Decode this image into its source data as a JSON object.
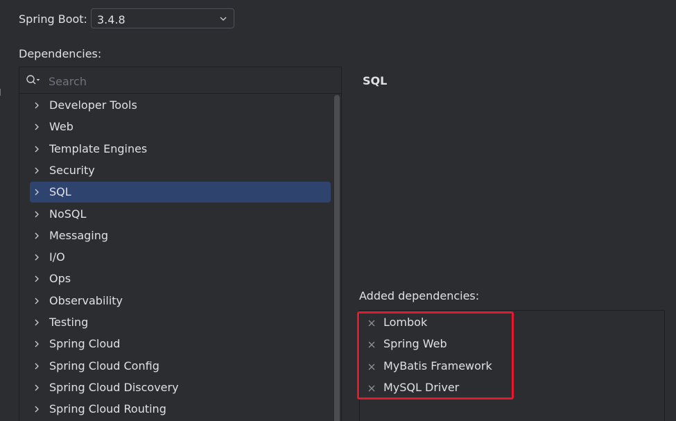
{
  "spring_boot": {
    "label": "Spring Boot:",
    "version": "3.4.8"
  },
  "dependencies": {
    "label": "Dependencies:",
    "search_placeholder": "Search",
    "categories": [
      {
        "label": "Developer Tools",
        "selected": false
      },
      {
        "label": "Web",
        "selected": false
      },
      {
        "label": "Template Engines",
        "selected": false
      },
      {
        "label": "Security",
        "selected": false
      },
      {
        "label": "SQL",
        "selected": true
      },
      {
        "label": "NoSQL",
        "selected": false
      },
      {
        "label": "Messaging",
        "selected": false
      },
      {
        "label": "I/O",
        "selected": false
      },
      {
        "label": "Ops",
        "selected": false
      },
      {
        "label": "Observability",
        "selected": false
      },
      {
        "label": "Testing",
        "selected": false
      },
      {
        "label": "Spring Cloud",
        "selected": false
      },
      {
        "label": "Spring Cloud Config",
        "selected": false
      },
      {
        "label": "Spring Cloud Discovery",
        "selected": false
      },
      {
        "label": "Spring Cloud Routing",
        "selected": false
      }
    ]
  },
  "detail": {
    "title": "SQL"
  },
  "added": {
    "label": "Added dependencies:",
    "items": [
      "Lombok",
      "Spring Web",
      "MyBatis Framework",
      "MySQL Driver"
    ]
  },
  "colors": {
    "background": "#2b2d30",
    "selection": "#2e436e",
    "highlight_box": "#e8182c",
    "text": "#dfe1e5"
  },
  "icons": {
    "search": "search-icon",
    "dropdown": "chevron-down-icon",
    "expand": "chevron-right-icon",
    "remove": "close-icon"
  }
}
